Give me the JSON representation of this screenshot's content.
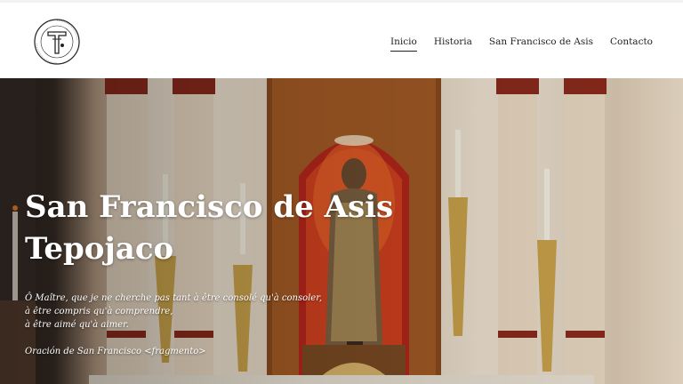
{
  "site": {
    "logo_icon": "parish-cross-seal-icon"
  },
  "nav": {
    "items": [
      {
        "label": "Inicio",
        "active": true
      },
      {
        "label": "Historia",
        "active": false
      },
      {
        "label": "San Francisco de Asis",
        "active": false
      },
      {
        "label": "Contacto",
        "active": false
      }
    ]
  },
  "hero": {
    "title_line1": "San Francisco de Asis",
    "title_line2": "Tepojaco",
    "quote": [
      "Ô Maître, que je ne cherche pas tant à être consolé qu'à consoler,",
      "à être compris qu'à comprendre,",
      "à être aimé qu'à aimer."
    ],
    "source": "Oración de San Francisco <fragmento>",
    "image_icon": "altar-saint-statue-photo"
  },
  "colors": {
    "header_bg": "#ffffff",
    "nav_text": "#222222",
    "hero_text": "#ffffff",
    "altar_red": "#c8371c",
    "column_cream": "#efe3d2",
    "gold": "#c9a24a"
  }
}
